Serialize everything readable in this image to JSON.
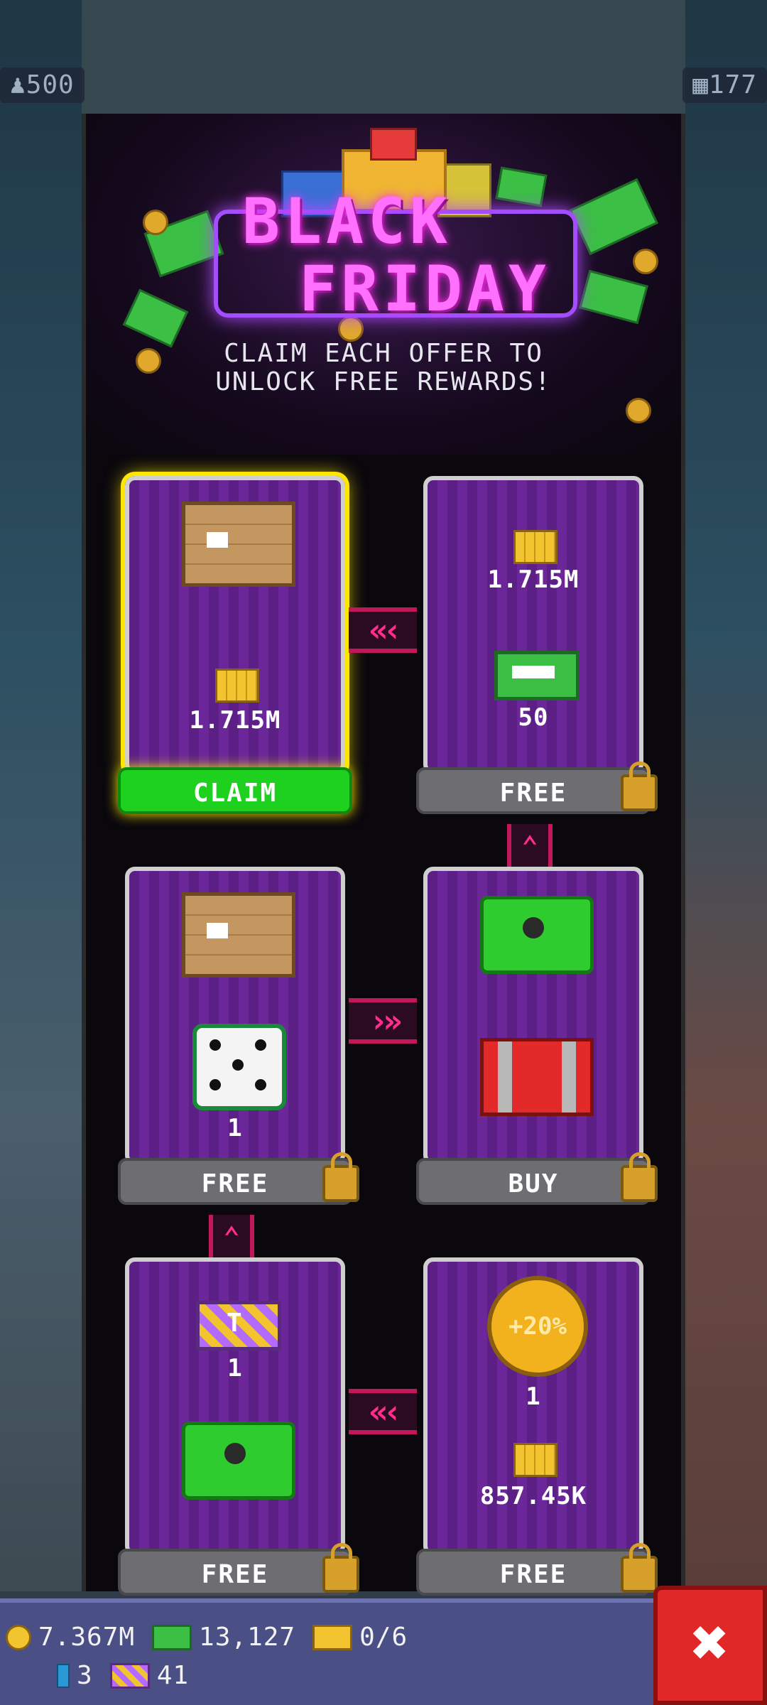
{
  "top_stats": {
    "population": "500",
    "floors": "177"
  },
  "banner": {
    "title_line1": "BLACK",
    "title_line2": "FRIDAY",
    "subtitle_line1": "CLAIM EACH OFFER TO",
    "subtitle_line2": "UNLOCK FREE REWARDS!"
  },
  "offers": [
    {
      "id": "offer-1",
      "reward_top": "crate",
      "reward_bottom_value": "1.715M",
      "button": "CLAIM",
      "locked": false
    },
    {
      "id": "offer-2",
      "reward_top_value": "1.715M",
      "reward_bottom_value": "50",
      "button": "FREE",
      "locked": true
    },
    {
      "id": "offer-3",
      "reward_top": "crate",
      "reward_bottom_value": "1",
      "button": "FREE",
      "locked": true
    },
    {
      "id": "offer-4",
      "reward_top": "green-chest",
      "reward_bottom": "red-chest",
      "button": "BUY",
      "locked": true
    },
    {
      "id": "offer-5",
      "reward_top_value": "1",
      "reward_bottom": "green-chest",
      "button": "FREE",
      "locked": true
    },
    {
      "id": "offer-6",
      "reward_top_label": "+20%",
      "reward_top_value": "1",
      "reward_bottom_value": "857.45K",
      "button": "FREE",
      "locked": true
    }
  ],
  "currency": {
    "coins": "7.367M",
    "bux": "13,127",
    "golden_tickets": "0/6",
    "blue_items": "3",
    "tower_tickets": "41"
  },
  "close_glyph": "✖"
}
